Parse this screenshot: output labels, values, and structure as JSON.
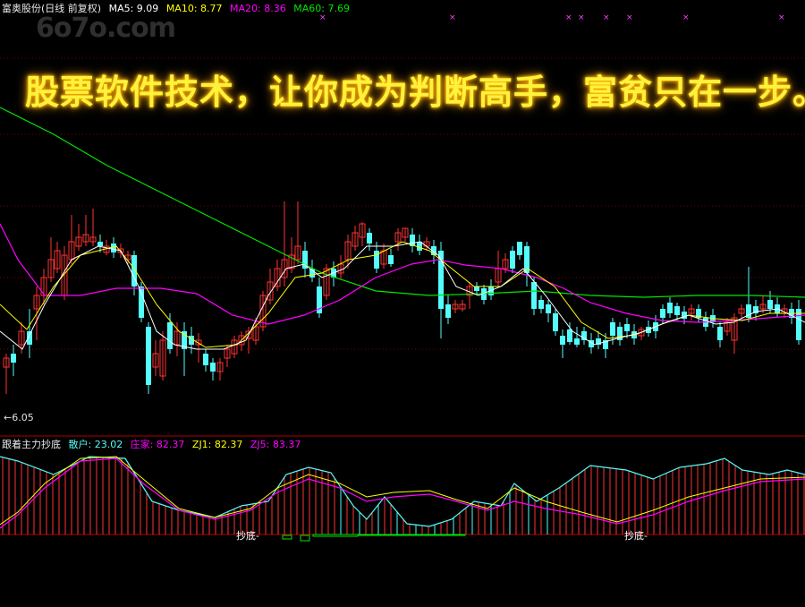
{
  "header": {
    "stock": "富奥股份(日线 前复权)",
    "ma5": "MA5: 9.09",
    "ma10": "MA10: 8.77",
    "ma20": "MA20: 8.36",
    "ma60": "MA60: 7.69"
  },
  "watermark": "6o7o.com",
  "promo_text": "股票软件技术，让你成为判断高手，富贫只在一步。",
  "low_label": "←6.05",
  "indicator": {
    "name": "跟着主力抄底",
    "sanhu": "散户: 23.02",
    "zhuangjia": "庄家: 82.37",
    "zj1": "ZJ1: 82.37",
    "zj5": "ZJ5: 83.37",
    "signal_label": "抄底"
  },
  "colors": {
    "up": "#ff3232",
    "down": "#54fcfc",
    "ma5": "#ffffff",
    "ma10": "#ffff00",
    "ma20": "#ff00ff",
    "ma60": "#00e600",
    "grid": "#7a0000",
    "promo": "#fff23a"
  },
  "chart_data": [
    {
      "type": "candlestick",
      "y_low_marker": 6.05,
      "series": [
        {
          "name": "MA5",
          "value": 9.09
        },
        {
          "name": "MA10",
          "value": 8.77
        },
        {
          "name": "MA20",
          "value": 8.36
        },
        {
          "name": "MA60",
          "value": 7.69
        }
      ]
    },
    {
      "type": "bar",
      "series": [
        {
          "name": "散户",
          "value": 23.02
        },
        {
          "name": "庄家",
          "value": 82.37
        },
        {
          "name": "ZJ1",
          "value": 82.37
        },
        {
          "name": "ZJ5",
          "value": 83.37
        }
      ]
    }
  ]
}
